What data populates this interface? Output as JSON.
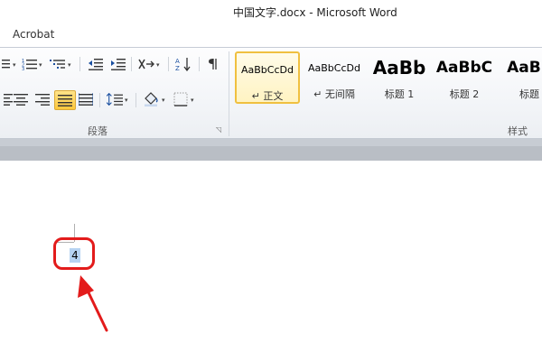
{
  "window": {
    "title": "中国文字.docx  -  Microsoft Word"
  },
  "tabs": {
    "visible_tab": "Acrobat"
  },
  "ribbon": {
    "paragraph_group_label": "段落",
    "styles_group_label": "样式",
    "styles": [
      {
        "sample": "AaBbCcDd",
        "name": "↵ 正文",
        "selected": true
      },
      {
        "sample": "AaBbCcDd",
        "name": "↵ 无间隔",
        "selected": false
      },
      {
        "sample": "AaBb",
        "name": "标题 1",
        "selected": false
      },
      {
        "sample": "AaBbC",
        "name": "标题 2",
        "selected": false
      },
      {
        "sample": "AaBb",
        "name": "标题",
        "selected": false
      }
    ]
  },
  "document": {
    "selected_text": "4",
    "annotation_color": "#e31b1b",
    "selection_color": "#b6d3f2"
  },
  "icons": [
    "bullets-icon",
    "numbering-icon",
    "multilevel-list-icon",
    "decrease-indent-icon",
    "increase-indent-icon",
    "chinese-layout-icon",
    "sort-icon",
    "show-marks-icon",
    "align-left-icon",
    "align-center-icon",
    "align-right-icon",
    "justify-icon",
    "distributed-icon",
    "line-spacing-icon",
    "shading-icon",
    "borders-icon"
  ]
}
